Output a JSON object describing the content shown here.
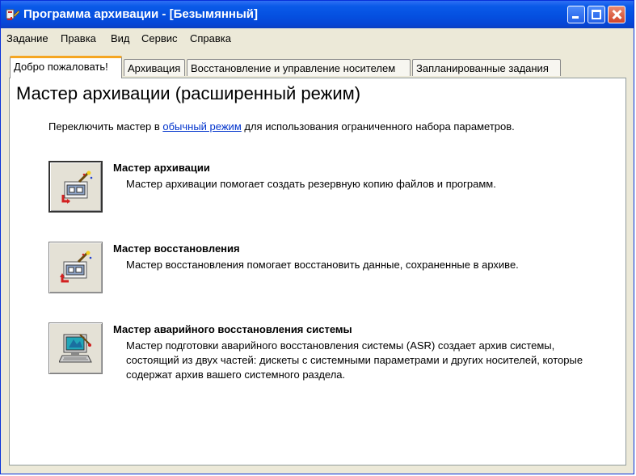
{
  "window": {
    "title": "Программа архивации - [Безымянный]"
  },
  "menu": [
    "Задание",
    "Правка",
    "Вид",
    "Сервис",
    "Справка"
  ],
  "tabs": [
    {
      "label": "Добро пожаловать!",
      "active": true
    },
    {
      "label": "Архивация",
      "active": false
    },
    {
      "label": "Восстановление и управление носителем",
      "active": false
    },
    {
      "label": "Запланированные задания",
      "active": false
    }
  ],
  "main": {
    "heading": "Мастер архивации (расширенный режим)",
    "intro_before": "Переключить мастер в ",
    "intro_link": "обычный режим",
    "intro_after": " для использования ограниченного набора параметров.",
    "wizards": [
      {
        "title": "Мастер архивации",
        "description": "Мастер архивации помогает создать резервную копию файлов и программ.",
        "icon": "backup-wizard-icon"
      },
      {
        "title": "Мастер восстановления",
        "description": "Мастер восстановления помогает восстановить данные, сохраненные в архиве.",
        "icon": "restore-wizard-icon"
      },
      {
        "title": "Мастер аварийного восстановления системы",
        "description_lines": [
          "Мастер подготовки аварийного восстановления системы (ASR) создает архив системы,",
          "состоящий из двух частей: дискеты с системными параметрами и других носителей, которые",
          "содержат архив вашего системного раздела."
        ],
        "icon": "asr-wizard-icon"
      }
    ]
  },
  "colors": {
    "titlebar": "#0550e0",
    "window_bg": "#ece9d8",
    "link": "#0033cc",
    "active_tab_accent": "#f5a623"
  }
}
